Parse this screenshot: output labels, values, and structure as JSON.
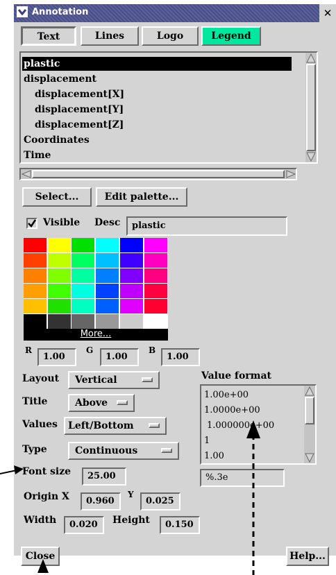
{
  "window": {
    "title": "Annotation",
    "close_glyph": "✕"
  },
  "tabs": [
    {
      "label": "Text",
      "active": false
    },
    {
      "label": "Lines",
      "active": false
    },
    {
      "label": "Logo",
      "active": false
    },
    {
      "label": "Legend",
      "active": true
    }
  ],
  "accent_color": "#00e8a0",
  "variables": [
    "plastic",
    "displacement",
    "displacement[X]",
    "displacement[Y]",
    "displacement[Z]",
    "Coordinates",
    "Time"
  ],
  "selected_variable": "plastic",
  "buttons": {
    "select": "Select...",
    "edit_palette": "Edit palette...",
    "close": "Close",
    "help": "Help...",
    "more": "More..."
  },
  "visible": {
    "label": "Visible",
    "checked": true
  },
  "desc": {
    "label": "Desc",
    "value": "plastic"
  },
  "palette": [
    [
      "#ff0000",
      "#ffff00",
      "#00e000",
      "#00ffff",
      "#0000ff",
      "#ff00ff"
    ],
    [
      "#ff4000",
      "#c0ff00",
      "#00ff60",
      "#00c0ff",
      "#4000ff",
      "#ff00c0"
    ],
    [
      "#ff8000",
      "#80ff00",
      "#00ffa0",
      "#0080ff",
      "#8000ff",
      "#ff0080"
    ],
    [
      "#ffa000",
      "#40ff00",
      "#00ffe0",
      "#0040ff",
      "#c000ff",
      "#ff0040"
    ],
    [
      "#ffc000",
      "#20e000",
      "#00ffc0",
      "#0060ff",
      "#e000ff",
      "#ff0030"
    ],
    [
      "#000000",
      "#333333",
      "#666666",
      "#999999",
      "#cccccc",
      "#ffffff"
    ]
  ],
  "rgb": {
    "r_label": "R",
    "r": "1.00",
    "g_label": "G",
    "g": "1.00",
    "b_label": "B",
    "b": "1.00"
  },
  "layout": {
    "label": "Layout",
    "value": "Vertical"
  },
  "title_opt": {
    "label": "Title",
    "value": "Above"
  },
  "values_opt": {
    "label": "Values",
    "value": "Left/Bottom"
  },
  "type_opt": {
    "label": "Type",
    "value": "Continuous"
  },
  "font_size": {
    "label": "Font size",
    "value": "25.00"
  },
  "origin": {
    "x_label": "Origin X",
    "x": "0.960",
    "y_label": "Y",
    "y": "0.025"
  },
  "size": {
    "width_label": "Width",
    "width": "0.020",
    "height_label": "Height",
    "height": "0.150"
  },
  "value_format": {
    "label": "Value format",
    "options": [
      "1.00e+00",
      "1.0000e+00",
      "1.000000e+00",
      "1",
      "1.00"
    ],
    "current": "%.3e"
  }
}
